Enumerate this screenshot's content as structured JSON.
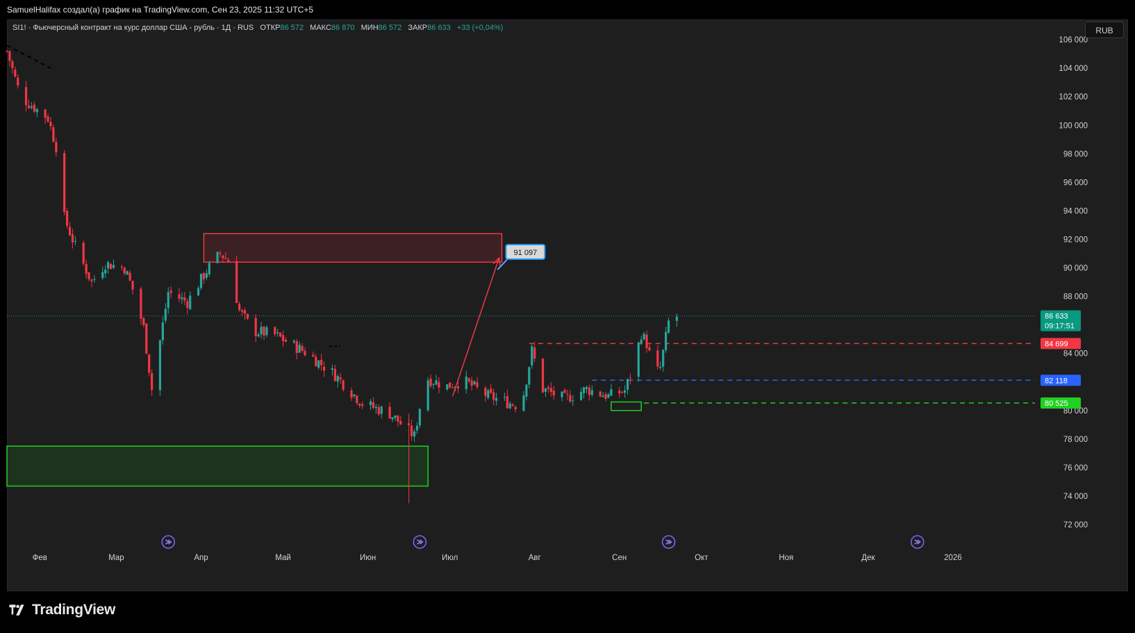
{
  "header": {
    "attribution": "SamuelHalifax создал(а) график на TradingView.com, Сен 23, 2025 11:32 UTC+5"
  },
  "legend": {
    "symbol": "SI1! · Фьючерсный контракт на курс доллар США - рубль · 1Д · RUS",
    "open_label": "ОТКР",
    "open": "86 572",
    "high_label": "МАКС",
    "high": "86 870",
    "low_label": "МИН",
    "low": "86 572",
    "close_label": "ЗАКР",
    "close": "86 633",
    "change": "+33 (+0,04%)"
  },
  "currency_button": "RUB",
  "logo": {
    "text": "TradingView"
  },
  "colors": {
    "up": "#26a69a",
    "down": "#f23645",
    "background": "#1e1e1e",
    "resistance": "#f23645",
    "support": "#2962ff",
    "green_zone": "#22d022"
  },
  "chart_data": {
    "type": "candlestick",
    "ylim": [
      71000,
      107500
    ],
    "yticks": [
      72000,
      74000,
      76000,
      78000,
      80000,
      84000,
      88000,
      90000,
      92000,
      94000,
      96000,
      98000,
      100000,
      102000,
      104000,
      106000
    ],
    "ytick_labels": [
      "72 000",
      "74 000",
      "76 000",
      "78 000",
      "80 000",
      "84 000",
      "88 000",
      "90 000",
      "92 000",
      "94 000",
      "96 000",
      "98 000",
      "100 000",
      "102 000",
      "104 000",
      "106 000"
    ],
    "xlim": [
      "2025-01-20",
      "2026-01-31"
    ],
    "month_ticks": [
      {
        "date": "2025-02-01",
        "label": "Фев"
      },
      {
        "date": "2025-03-01",
        "label": "Мар"
      },
      {
        "date": "2025-04-01",
        "label": "Апр"
      },
      {
        "date": "2025-05-01",
        "label": "Май"
      },
      {
        "date": "2025-06-01",
        "label": "Июн"
      },
      {
        "date": "2025-07-01",
        "label": "Июл"
      },
      {
        "date": "2025-08-01",
        "label": "Авг"
      },
      {
        "date": "2025-09-01",
        "label": "Сен"
      },
      {
        "date": "2025-10-01",
        "label": "Окт"
      },
      {
        "date": "2025-11-01",
        "label": "Ноя"
      },
      {
        "date": "2025-12-01",
        "label": "Дек"
      },
      {
        "date": "2026-01-01",
        "label": "2026"
      }
    ],
    "anchors": [
      [
        "2025-01-20",
        105200
      ],
      [
        "2025-01-25",
        102000
      ],
      [
        "2025-02-04",
        100500
      ],
      [
        "2025-02-07",
        98500
      ],
      [
        "2025-02-10",
        93500
      ],
      [
        "2025-02-14",
        91500
      ],
      [
        "2025-02-20",
        89000
      ],
      [
        "2025-02-25",
        90300
      ],
      [
        "2025-03-04",
        90000
      ],
      [
        "2025-03-07",
        88500
      ],
      [
        "2025-03-11",
        85800
      ],
      [
        "2025-03-14",
        81500
      ],
      [
        "2025-03-20",
        88300
      ],
      [
        "2025-03-27",
        87600
      ],
      [
        "2025-04-03",
        89800
      ],
      [
        "2025-04-08",
        91000
      ],
      [
        "2025-04-11",
        90500
      ],
      [
        "2025-04-15",
        87000
      ],
      [
        "2025-04-20",
        85600
      ],
      [
        "2025-04-28",
        85300
      ],
      [
        "2025-05-10",
        84000
      ],
      [
        "2025-05-20",
        82500
      ],
      [
        "2025-05-30",
        80500
      ],
      [
        "2025-06-09",
        79800
      ],
      [
        "2025-06-18",
        78200
      ],
      [
        "2025-06-22",
        82300
      ],
      [
        "2025-06-30",
        81700
      ],
      [
        "2025-07-06",
        82100
      ],
      [
        "2025-07-15",
        81000
      ],
      [
        "2025-07-25",
        80400
      ],
      [
        "2025-07-28",
        81200
      ],
      [
        "2025-07-31",
        84200
      ],
      [
        "2025-08-04",
        81500
      ],
      [
        "2025-08-12",
        80800
      ],
      [
        "2025-08-20",
        81500
      ],
      [
        "2025-08-28",
        81000
      ],
      [
        "2025-09-03",
        81400
      ],
      [
        "2025-09-06",
        83000
      ],
      [
        "2025-09-09",
        85400
      ],
      [
        "2025-09-11",
        84700
      ],
      [
        "2025-09-14",
        82500
      ],
      [
        "2025-09-16",
        83000
      ],
      [
        "2025-09-19",
        86200
      ],
      [
        "2025-09-22",
        86600
      ]
    ],
    "last_price": 86633,
    "price_tags": [
      {
        "value": 86633,
        "label": "86 633",
        "sublabel": "09:17:51",
        "color": "#089981"
      },
      {
        "value": 84699,
        "label": "84 699",
        "color": "#f23645"
      },
      {
        "value": 82118,
        "label": "82 118",
        "color": "#2962ff"
      },
      {
        "value": 80525,
        "label": "80 525",
        "color": "#22d022"
      }
    ],
    "levels": [
      {
        "value": 84699,
        "from": "2025-07-30",
        "color": "#f23645"
      },
      {
        "value": 82118,
        "from": "2025-08-22",
        "color": "#2962ff"
      },
      {
        "value": 80525,
        "from": "2025-09-10",
        "color": "#22d022"
      }
    ],
    "zones": [
      {
        "from": "2025-04-02",
        "to": "2025-07-20",
        "top": 92400,
        "bottom": 90400,
        "color": "#f23645",
        "fill": "rgba(242,54,69,0.14)"
      },
      {
        "from": "2025-01-20",
        "to": "2025-06-23",
        "top": 77500,
        "bottom": 74700,
        "color": "#22d022",
        "fill": "rgba(34,208,34,0.12)"
      },
      {
        "from": "2025-08-29",
        "to": "2025-09-09",
        "top": 80600,
        "bottom": 80000,
        "color": "#22d022",
        "fill": "rgba(0,0,0,0)"
      }
    ],
    "arrow": {
      "from": [
        "2025-07-02",
        81000
      ],
      "to": [
        "2025-07-19",
        90700
      ]
    },
    "callout": {
      "label": "91 097",
      "at": [
        "2025-07-21",
        91097
      ]
    },
    "trend_dash": {
      "from": [
        "2025-01-20",
        105600
      ],
      "to": [
        "2025-02-05",
        104000
      ]
    },
    "small_dash": {
      "at": [
        "2025-05-18",
        84500
      ]
    },
    "spike": {
      "date": "2025-06-16",
      "low": 73500
    },
    "event_markers": [
      "2025-03-20",
      "2025-06-20",
      "2025-09-19",
      "2025-12-19"
    ]
  }
}
